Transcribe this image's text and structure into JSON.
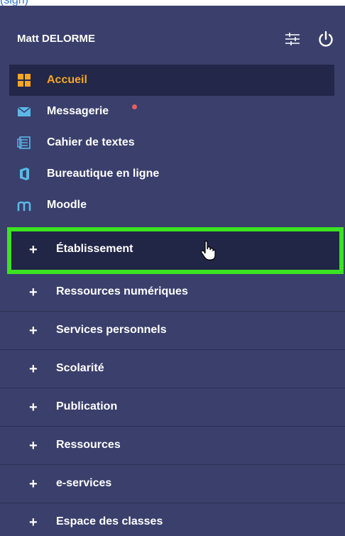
{
  "top_note": "(sign)",
  "user": {
    "name": "Matt DELORME"
  },
  "quick_links": [
    {
      "label": "Accueil",
      "icon": "grid-icon"
    },
    {
      "label": "Messagerie",
      "icon": "mail-icon",
      "badge": "unread-dot"
    },
    {
      "label": "Cahier de textes",
      "icon": "notebook-icon"
    },
    {
      "label": "Bureautique en ligne",
      "icon": "office-icon"
    },
    {
      "label": "Moodle",
      "icon": "moodle-icon"
    }
  ],
  "sections": [
    {
      "label": "Établissement"
    },
    {
      "label": "Ressources numériques"
    },
    {
      "label": "Services personnels"
    },
    {
      "label": "Scolarité"
    },
    {
      "label": "Publication"
    },
    {
      "label": "Ressources"
    },
    {
      "label": "e-services"
    },
    {
      "label": "Espace des classes"
    }
  ],
  "section_prefix": "+",
  "colors": {
    "panel_bg": "#3a3f6c",
    "active_bg": "#232749",
    "active_text": "#f5a623",
    "highlight_border": "#3be321",
    "icon_blue": "#5bb8e8",
    "badge_red": "#e85d5d"
  }
}
